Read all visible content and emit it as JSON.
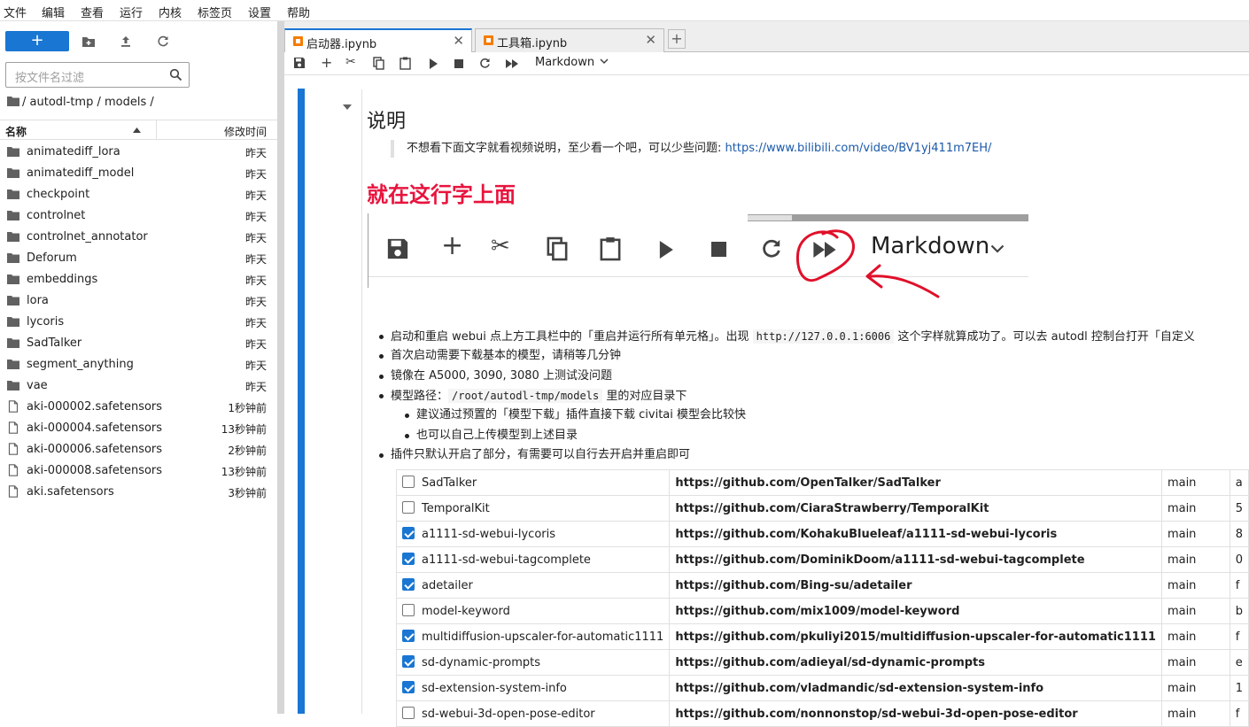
{
  "menu": [
    "文件",
    "编辑",
    "查看",
    "运行",
    "内核",
    "标签页",
    "设置",
    "帮助"
  ],
  "filebrowser": {
    "new_label": "+",
    "filter_placeholder": "按文件名过滤",
    "breadcrumb": "/ autodl-tmp / models /",
    "col_name": "名称",
    "col_modified": "修改时间",
    "items": [
      {
        "name": "animatediff_lora",
        "time": "昨天",
        "type": "folder"
      },
      {
        "name": "animatediff_model",
        "time": "昨天",
        "type": "folder"
      },
      {
        "name": "checkpoint",
        "time": "昨天",
        "type": "folder"
      },
      {
        "name": "controlnet",
        "time": "昨天",
        "type": "folder"
      },
      {
        "name": "controlnet_annotator",
        "time": "昨天",
        "type": "folder"
      },
      {
        "name": "Deforum",
        "time": "昨天",
        "type": "folder"
      },
      {
        "name": "embeddings",
        "time": "昨天",
        "type": "folder"
      },
      {
        "name": "lora",
        "time": "昨天",
        "type": "folder"
      },
      {
        "name": "lycoris",
        "time": "昨天",
        "type": "folder"
      },
      {
        "name": "SadTalker",
        "time": "昨天",
        "type": "folder"
      },
      {
        "name": "segment_anything",
        "time": "昨天",
        "type": "folder"
      },
      {
        "name": "vae",
        "time": "昨天",
        "type": "folder"
      },
      {
        "name": "aki-000002.safetensors",
        "time": "1秒钟前",
        "type": "file"
      },
      {
        "name": "aki-000004.safetensors",
        "time": "13秒钟前",
        "type": "file"
      },
      {
        "name": "aki-000006.safetensors",
        "time": "2秒钟前",
        "type": "file"
      },
      {
        "name": "aki-000008.safetensors",
        "time": "13秒钟前",
        "type": "file"
      },
      {
        "name": "aki.safetensors",
        "time": "3秒钟前",
        "type": "file"
      }
    ]
  },
  "tabs": [
    {
      "label": "启动器.ipynb",
      "active": true
    },
    {
      "label": "工具箱.ipynb",
      "active": false
    }
  ],
  "toolbar": {
    "cell_type": "Markdown"
  },
  "notebook": {
    "heading": "说明",
    "quote_text": "不想看下面文字就看视频说明，至少看一个吧，可以少些问题: ",
    "quote_link": "https://www.bilibili.com/video/BV1yj411m7EH/",
    "red_heading": "就在这行字上面",
    "embed_cell_type": "Markdown",
    "bullets": {
      "b1_pre": "启动和重启 webui 点上方工具栏中的「重启并运行所有单元格」。出现 ",
      "b1_code": "http://127.0.0.1:6006",
      "b1_post": " 这个字样就算成功了。可以去 autodl 控制台打开「自定义",
      "b2": "首次启动需要下载基本的模型，请稍等几分钟",
      "b3": "镜像在 A5000, 3090, 3080 上测试没问题",
      "b4_pre": "模型路径：",
      "b4_code": "/root/autodl-tmp/models",
      "b4_post": " 里的对应目录下",
      "b4a": "建议通过预置的「模型下载」插件直接下载 civitai 模型会比较快",
      "b4b": "也可以自己上传模型到上述目录",
      "b5": "插件只默认开启了部分，有需要可以自行去开启并重启即可"
    },
    "plugins": [
      {
        "name": "SadTalker",
        "url": "https://github.com/OpenTalker/SadTalker",
        "branch": "main",
        "extra": "a",
        "checked": false
      },
      {
        "name": "TemporalKit",
        "url": "https://github.com/CiaraStrawberry/TemporalKit",
        "branch": "main",
        "extra": "5",
        "checked": false
      },
      {
        "name": "a1111-sd-webui-lycoris",
        "url": "https://github.com/KohakuBlueleaf/a1111-sd-webui-lycoris",
        "branch": "main",
        "extra": "8",
        "checked": true
      },
      {
        "name": "a1111-sd-webui-tagcomplete",
        "url": "https://github.com/DominikDoom/a1111-sd-webui-tagcomplete",
        "branch": "main",
        "extra": "0",
        "checked": true
      },
      {
        "name": "adetailer",
        "url": "https://github.com/Bing-su/adetailer",
        "branch": "main",
        "extra": "f",
        "checked": true
      },
      {
        "name": "model-keyword",
        "url": "https://github.com/mix1009/model-keyword",
        "branch": "main",
        "extra": "b",
        "checked": false
      },
      {
        "name": "multidiffusion-upscaler-for-automatic1111",
        "url": "https://github.com/pkuliyi2015/multidiffusion-upscaler-for-automatic1111",
        "branch": "main",
        "extra": "f",
        "checked": true
      },
      {
        "name": "sd-dynamic-prompts",
        "url": "https://github.com/adieyal/sd-dynamic-prompts",
        "branch": "main",
        "extra": "e",
        "checked": true
      },
      {
        "name": "sd-extension-system-info",
        "url": "https://github.com/vladmandic/sd-extension-system-info",
        "branch": "main",
        "extra": "1",
        "checked": true
      },
      {
        "name": "sd-webui-3d-open-pose-editor",
        "url": "https://github.com/nonnonstop/sd-webui-3d-open-pose-editor",
        "branch": "main",
        "extra": "f",
        "checked": false
      }
    ]
  }
}
